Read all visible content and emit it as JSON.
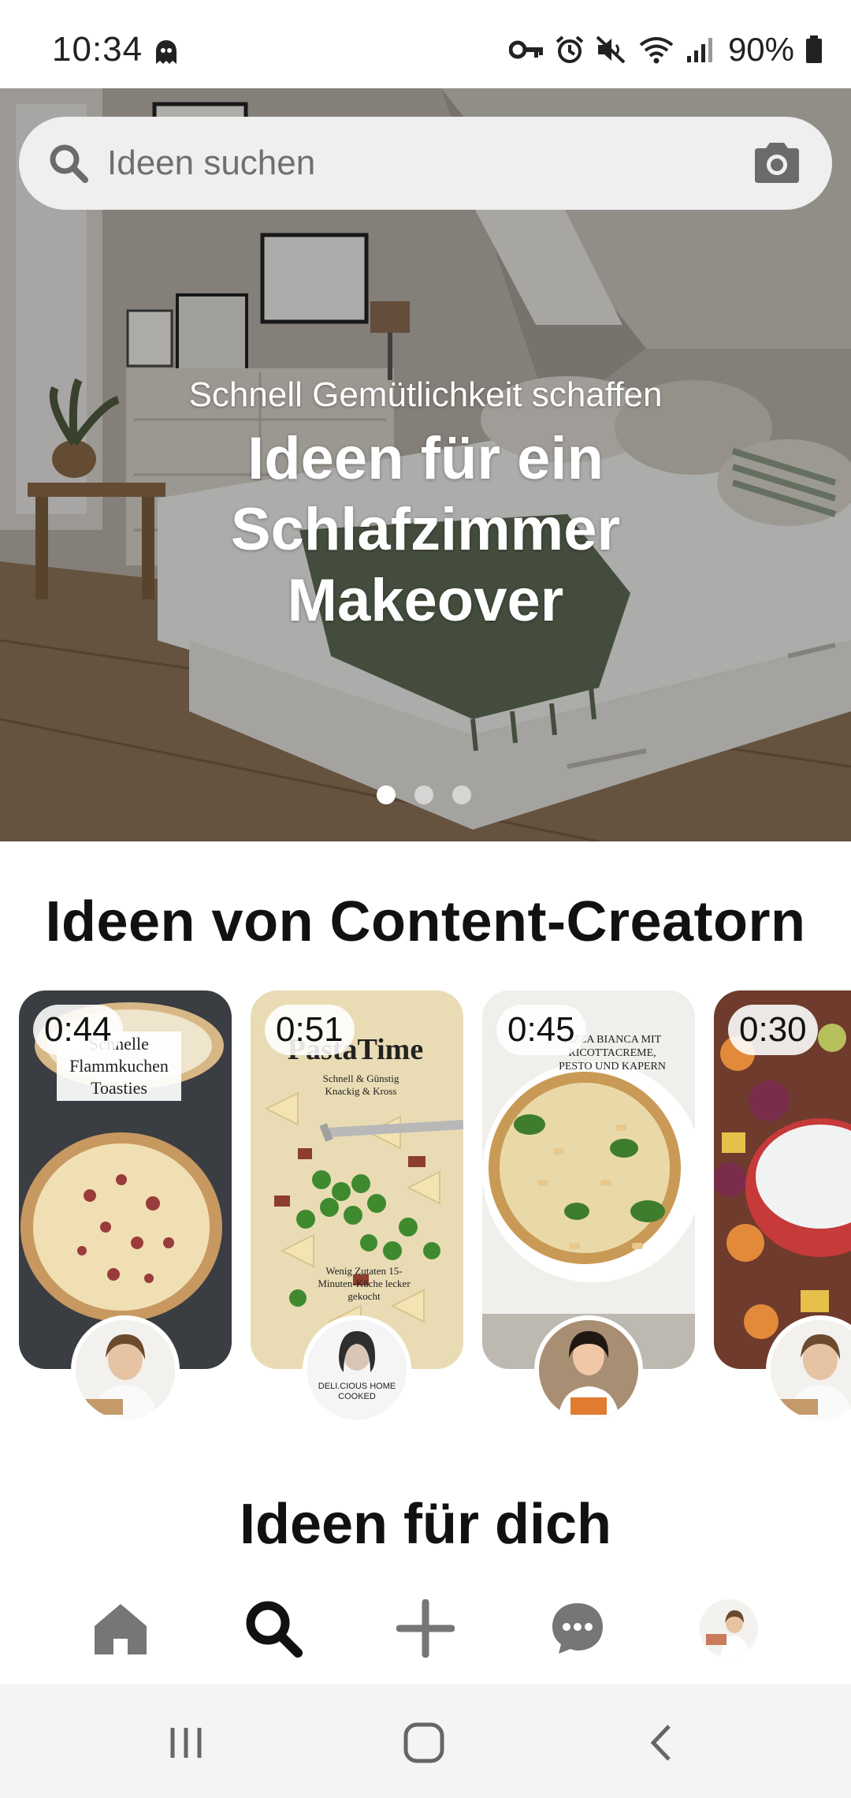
{
  "status_bar": {
    "time": "10:34",
    "battery": "90%",
    "icons": [
      "ghost-icon",
      "vpn-key-icon",
      "alarm-icon",
      "mute-icon",
      "wifi-icon",
      "signal-icon",
      "battery-icon"
    ]
  },
  "search": {
    "placeholder": "Ideen suchen",
    "left_icon": "search-icon",
    "right_icon": "camera-icon"
  },
  "hero": {
    "subtitle": "Schnell Gemütlichkeit schaffen",
    "title": "Ideen für ein Schlafzimmer Makeover",
    "page_count": 3,
    "active_page": 1
  },
  "creators_section": {
    "title": "Ideen von Content-Creatorn",
    "cards": [
      {
        "duration": "0:44",
        "caption": "Schnelle Flammkuchen Toasties",
        "avatar": "creator-avatar-1"
      },
      {
        "duration": "0:51",
        "caption": "PastaTime",
        "sub_caption": "Schnell & Günstig Knackig & Kross",
        "bottom_caption": "Wenig Zutaten 15-Minuten-Küche lecker gekocht",
        "avatar_label": "DELI.CIOUS HOME COOKED",
        "avatar": "creator-avatar-2"
      },
      {
        "duration": "0:45",
        "caption": "PIZZA BIANCA MIT RICOTTACREME, PESTO UND KAPERN",
        "avatar": "creator-avatar-3"
      },
      {
        "duration": "0:30",
        "caption": "",
        "avatar": "creator-avatar-1"
      }
    ]
  },
  "foryou_section": {
    "title": "Ideen für dich"
  },
  "bottom_nav": {
    "items": [
      "home-icon",
      "search-icon",
      "add-icon",
      "messages-icon",
      "profile-avatar"
    ],
    "active": "search-icon"
  },
  "system_nav": {
    "items": [
      "recents-button",
      "home-button",
      "back-button"
    ]
  },
  "colors": {
    "search_bg": "#efefef",
    "text_primary": "#111111",
    "nav_icon": "#767676",
    "nav_icon_active": "#111111"
  }
}
